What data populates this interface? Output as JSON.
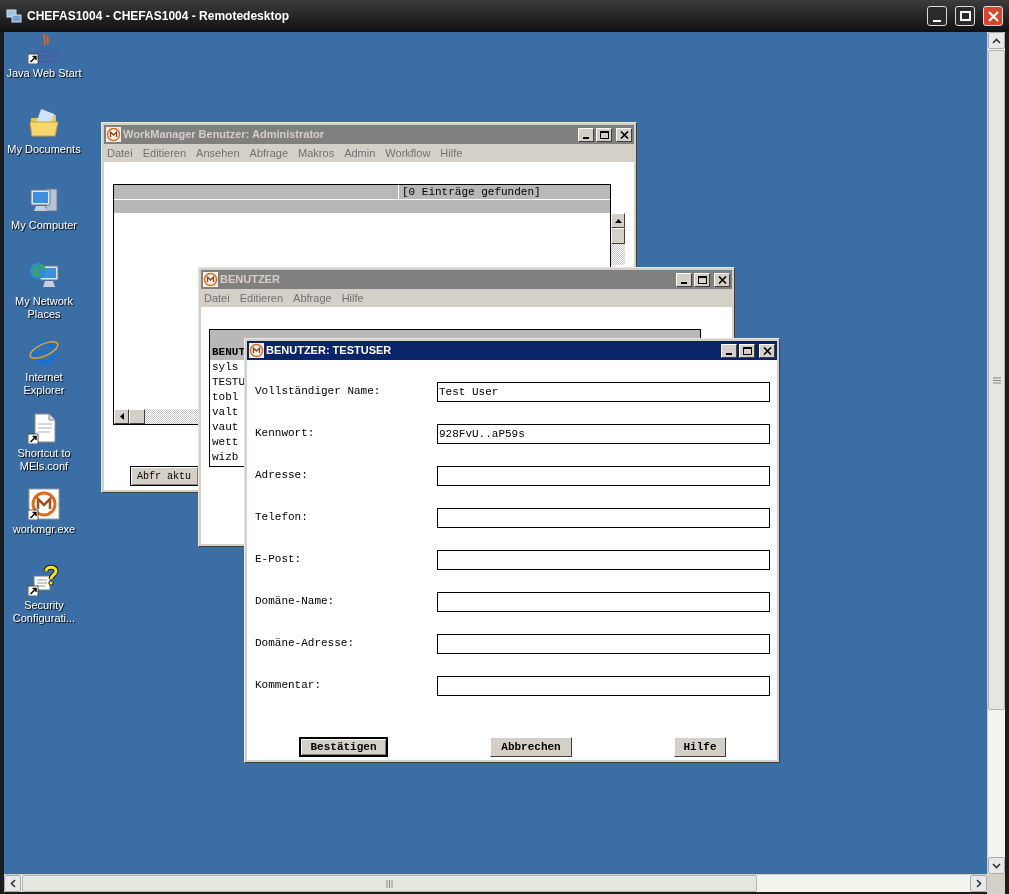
{
  "remote_window": {
    "title": "CHEFAS1004 - CHEFAS1004 - Remotedesktop"
  },
  "desktop_icons": [
    {
      "kind": "java",
      "label": "Java Web Start",
      "shortcut": true
    },
    {
      "kind": "folder",
      "label": "My Documents",
      "shortcut": false
    },
    {
      "kind": "computer",
      "label": "My Computer",
      "shortcut": false
    },
    {
      "kind": "network",
      "label": "My Network Places",
      "shortcut": false
    },
    {
      "kind": "browser",
      "label": "Internet Explorer",
      "shortcut": false
    },
    {
      "kind": "document",
      "label": "Shortcut to MEls.conf",
      "shortcut": true
    },
    {
      "kind": "app",
      "label": "workmgr.exe",
      "shortcut": true
    },
    {
      "kind": "security",
      "label": "Security Configurati...",
      "shortcut": true
    }
  ],
  "windows": [
    {
      "title": "WorkManager Benutzer: Administrator",
      "active": false,
      "menu": [
        "Datei",
        "Editieren",
        "Ansehen",
        "Abfrage",
        "Makros",
        "Admin",
        "Workflow",
        "Hilfe"
      ],
      "table": {
        "status": "[0 Einträge gefunden]"
      },
      "button": "Abfr aktu"
    },
    {
      "title": "BENUTZER",
      "active": false,
      "menu": [
        "Datei",
        "Editieren",
        "Abfrage",
        "Hilfe"
      ],
      "list": [
        {
          "text": "BENUT",
          "selected": true
        },
        {
          "text": "syls",
          "selected": false
        },
        {
          "text": "TESTU",
          "selected": false
        },
        {
          "text": "tobl",
          "selected": false
        },
        {
          "text": "valt",
          "selected": false
        },
        {
          "text": "vaut",
          "selected": false
        },
        {
          "text": "wett",
          "selected": false
        },
        {
          "text": "wizb",
          "selected": false
        }
      ]
    },
    {
      "title": "BENUTZER: TESTUSER",
      "active": true,
      "form": [
        {
          "label": "Vollständiger Name:",
          "value": "Test User"
        },
        {
          "label": "Kennwort:",
          "value": "928FvU..aP59s"
        },
        {
          "label": "Adresse:"
        },
        {
          "label": "Telefon:"
        },
        {
          "label": "E-Post:"
        },
        {
          "label": "Domäne-Name:"
        },
        {
          "label": "Domäne-Adresse:"
        },
        {
          "label": "Kommentar:"
        }
      ],
      "buttons": [
        {
          "label": "Bestätigen",
          "default": true
        },
        {
          "label": "Abbrechen",
          "default": false
        },
        {
          "label": "Hilfe",
          "default": false
        }
      ]
    }
  ]
}
